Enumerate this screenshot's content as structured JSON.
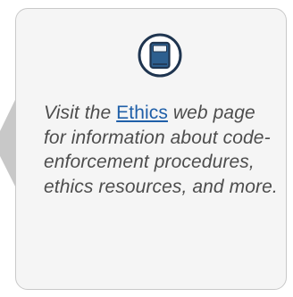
{
  "tip": {
    "text_before": "Visit the ",
    "link_label": "Ethics",
    "text_after": " web page for information about code-enforcement procedures, ethics resources, and more."
  },
  "icon": {
    "name": "book-icon",
    "ring_color": "#1f3550",
    "fill_color": "#2d5f8f"
  },
  "colors": {
    "card_background": "#f5f5f5",
    "pointer": "#c8c8c8",
    "link": "#1f5fa8",
    "text": "#4d4d4d"
  }
}
